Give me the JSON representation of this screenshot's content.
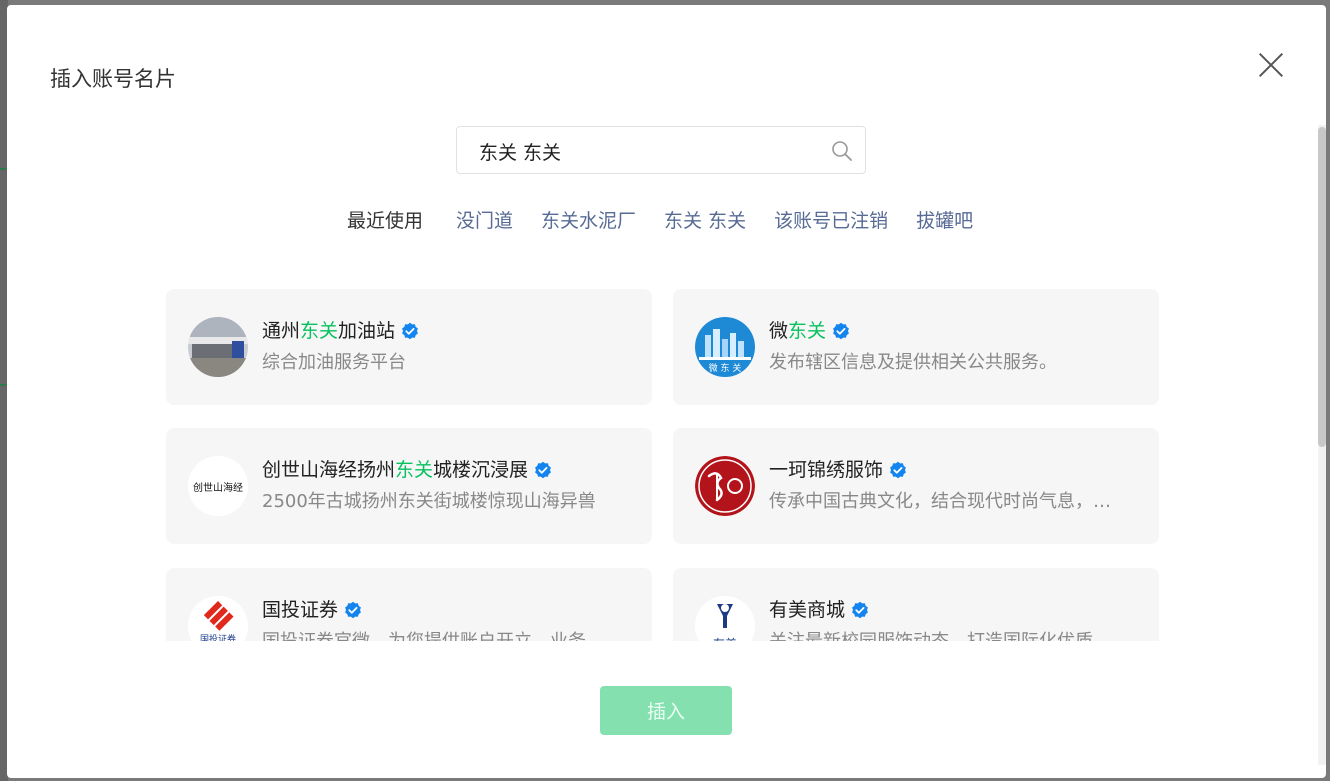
{
  "dialog": {
    "title": "插入账号名片",
    "close_icon": "close-icon"
  },
  "search": {
    "value": "东关 东关",
    "icon": "search-icon"
  },
  "recent": {
    "label": "最近使用",
    "items": [
      "没门道",
      "东关水泥厂",
      "东关 东关",
      "该账号已注销",
      "拔罐吧"
    ]
  },
  "accounts": [
    {
      "name_pre": "通州",
      "name_hl": "东关",
      "name_post": "加油站",
      "verified": true,
      "desc": "综合加油服务平台"
    },
    {
      "name_pre": "微",
      "name_hl": "东关",
      "name_post": "",
      "verified": true,
      "desc": "发布辖区信息及提供相关公共服务。"
    },
    {
      "name_pre": "创世山海经扬州",
      "name_hl": "东关",
      "name_post": "城楼沉浸展",
      "verified": true,
      "desc": "2500年古城扬州东关街城楼惊现山海异兽"
    },
    {
      "name_pre": "一珂锦绣服饰",
      "name_hl": "",
      "name_post": "",
      "verified": true,
      "desc": "传承中国古典文化，结合现代时尚气息，打造"
    },
    {
      "name_pre": "国投证券",
      "name_hl": "",
      "name_post": "",
      "verified": true,
      "desc": "国投证券官微，为您提供账户开立、业务"
    },
    {
      "name_pre": "有美商城",
      "name_hl": "",
      "name_post": "",
      "verified": true,
      "desc": "关注最新校园服饰动态，打造国际化优质"
    }
  ],
  "avatar_text": {
    "wei_dongguan": "微 东 关",
    "chuangshi": "创世山海经",
    "guotou": "国投证券",
    "youmei": "有美"
  },
  "footer": {
    "insert_label": "插入"
  },
  "colors": {
    "highlight": "#07c160",
    "link": "#576b95",
    "insert_button_disabled": "#85e0b0",
    "verified_badge": "#1485ee"
  }
}
